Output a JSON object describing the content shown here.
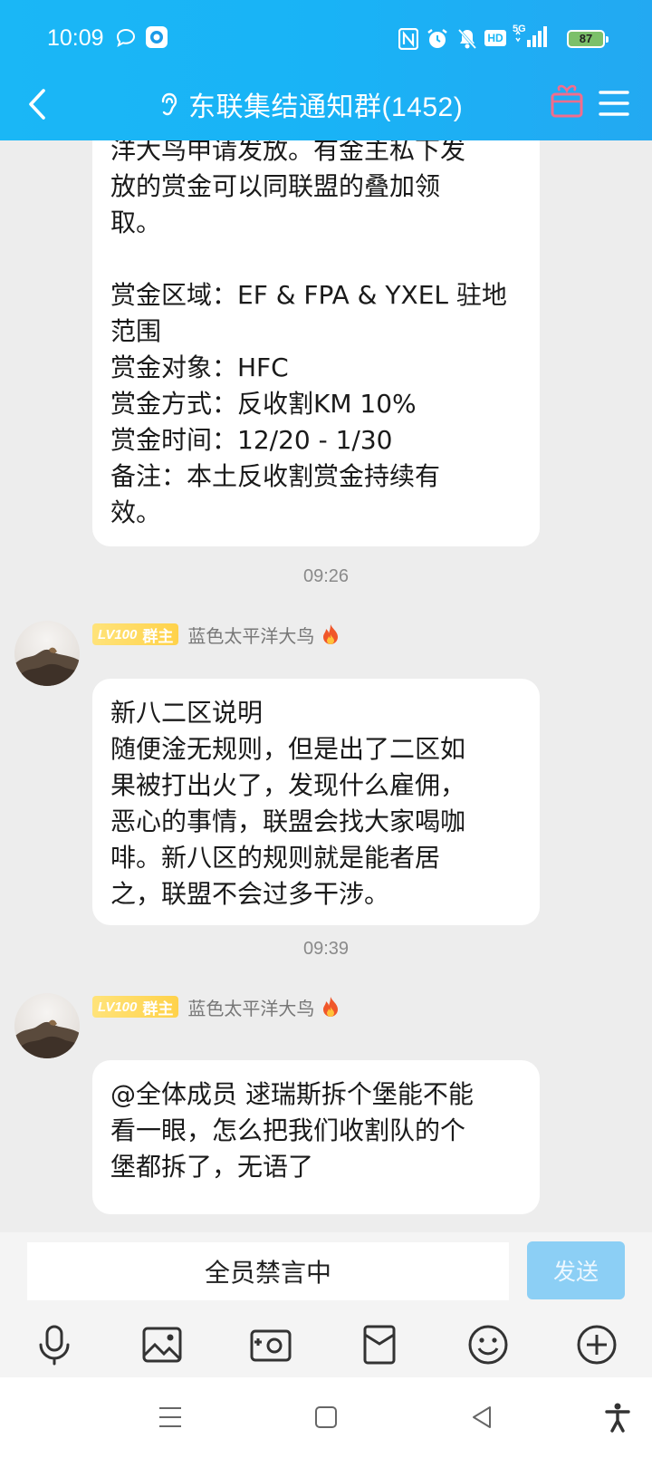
{
  "status_bar": {
    "time": "10:09",
    "battery": "87",
    "icons": [
      "qq-bubble-icon",
      "qq-logo-icon",
      "nfc-icon",
      "alarm-icon",
      "mute-icon",
      "hd-icon",
      "5g-signal-icon",
      "battery-icon"
    ],
    "hd_label": "HD",
    "network_label": "5G"
  },
  "header": {
    "title": "东联集结通知群(1452)",
    "accent_color": "#1ab7f6",
    "icons": [
      "back-icon",
      "earpiece-icon",
      "gift-icon",
      "menu-icon"
    ]
  },
  "messages": [
    {
      "id": "m1",
      "text": "洋大鸟申请发放。有金主私下发\n放的赏金可以同联盟的叠加领\n取。\n\n赏金区域：EF & FPA & YXEL 驻地\n范围\n赏金对象：HFC\n赏金方式：反收割KM 10%\n赏金时间：12/20 - 1/30\n备注：本土反收割赏金持续有\n效。"
    },
    {
      "id": "m2",
      "time": "09:26",
      "sender": {
        "level": "LV100",
        "role": "群主",
        "name": "蓝色太平洋大鸟",
        "flame": "flame-icon"
      },
      "text": "新八二区说明\n随便淦无规则，但是出了二区如\n果被打出火了，发现什么雇佣，\n恶心的事情，联盟会找大家喝咖\n啡。新八区的规则就是能者居\n之，联盟不会过多干涉。"
    },
    {
      "id": "m3",
      "time": "09:39",
      "sender": {
        "level": "LV100",
        "role": "群主",
        "name": "蓝色太平洋大鸟",
        "flame": "flame-icon"
      },
      "text": "@全体成员 逑瑞斯拆个堡能不能\n看一眼，怎么把我们收割队的个\n堡都拆了，无语了"
    }
  ],
  "input": {
    "muted_text": "全员禁言中",
    "send_label": "发送",
    "toolbar_icons": [
      "microphone-icon",
      "image-icon",
      "camera-icon",
      "red-packet-icon",
      "emoji-icon",
      "plus-icon"
    ]
  },
  "nav": {
    "icons": [
      "menu-lines-icon",
      "home-square-icon",
      "back-triangle-icon",
      "accessibility-icon"
    ]
  }
}
